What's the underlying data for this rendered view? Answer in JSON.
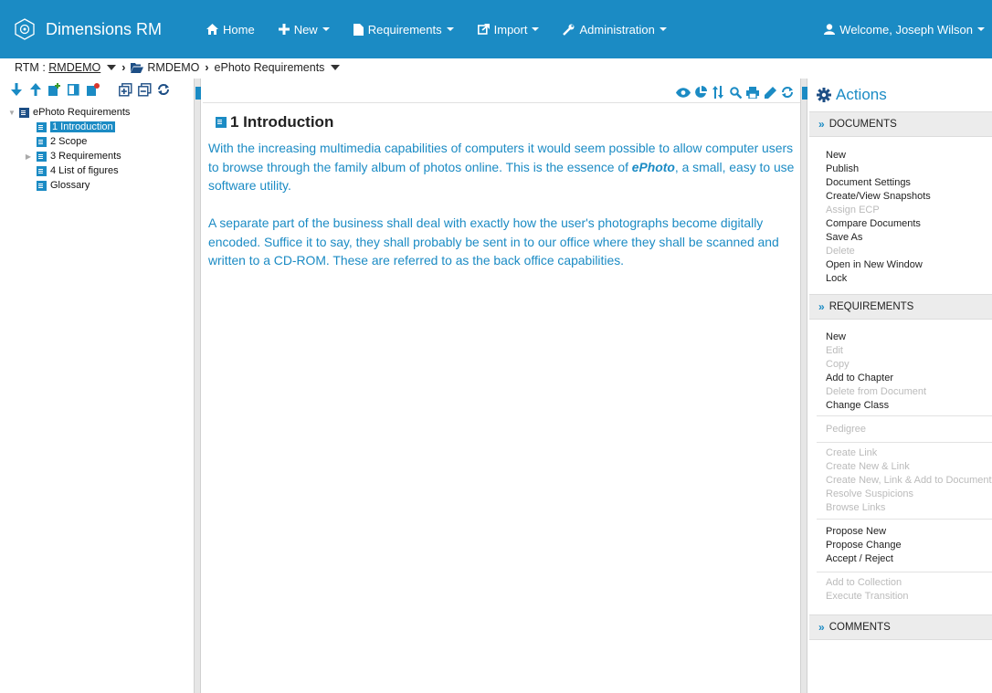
{
  "brand": {
    "title": "Dimensions RM"
  },
  "nav": {
    "home": "Home",
    "new": "New",
    "requirements": "Requirements",
    "import": "Import",
    "administration": "Administration",
    "welcome": "Welcome, Joseph Wilson"
  },
  "breadcrumb": {
    "prefix": "RTM :",
    "project": "RMDEMO",
    "folder": "RMDEMO",
    "document": "ePhoto Requirements"
  },
  "tree": {
    "root": "ePhoto Requirements",
    "items": [
      {
        "label": "1 Introduction",
        "selected": true
      },
      {
        "label": "2 Scope"
      },
      {
        "label": "3 Requirements"
      },
      {
        "label": "4 List of figures"
      },
      {
        "label": "Glossary"
      }
    ]
  },
  "content": {
    "heading": "1 Introduction",
    "para1_before": "With the increasing multimedia capabilities of computers it would seem possible to allow computer users to browse through the family album of photos online. This is the essence of ",
    "para1_em": "ePhoto",
    "para1_after": ", a small, easy to use software utility.",
    "para2": "A separate part of the business shall deal with exactly how the user's photographs become digitally encoded. Suffice it to say, they shall probably be sent in to our office where they shall be scanned and written to a CD-ROM. These are referred to as the back office capabilities."
  },
  "actions": {
    "title": "Actions",
    "documents": {
      "label": "DOCUMENTS",
      "items": [
        "New",
        "Publish",
        "Document Settings",
        "Create/View Snapshots",
        "Assign ECP",
        "Compare Documents",
        "Save As",
        "Delete",
        "Open in New Window",
        "Lock"
      ]
    },
    "requirements": {
      "label": "REQUIREMENTS",
      "group1": [
        "New",
        "Edit",
        "Copy",
        "Add to Chapter",
        "Delete from Document",
        "Change Class"
      ],
      "group2": [
        "Pedigree"
      ],
      "group3": [
        "Create Link",
        "Create New & Link",
        "Create New, Link & Add to Document",
        "Resolve Suspicions",
        "Browse Links"
      ],
      "group4": [
        "Propose New",
        "Propose Change",
        "Accept / Reject"
      ],
      "group5": [
        "Add to Collection",
        "Execute Transition"
      ]
    },
    "comments": {
      "label": "COMMENTS"
    }
  },
  "colors": {
    "accent": "#1b8bc4",
    "disabled": "#bbbbbb"
  }
}
